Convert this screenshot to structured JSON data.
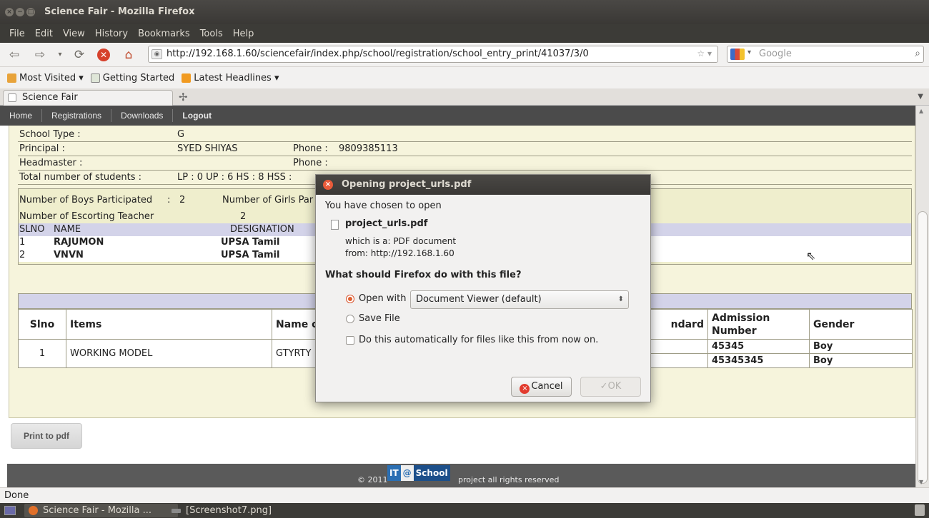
{
  "window": {
    "title": "Science Fair - Mozilla Firefox",
    "controls": [
      "×",
      "−",
      "□"
    ]
  },
  "menu": [
    "File",
    "Edit",
    "View",
    "History",
    "Bookmarks",
    "Tools",
    "Help"
  ],
  "toolbar": {
    "url": "http://192.168.1.60/sciencefair/index.php/school/registration/school_entry_print/41037/3/0",
    "search_placeholder": "Google",
    "icons": [
      "back-icon",
      "forward-icon",
      "history-dropdown-icon",
      "reload-icon",
      "stop-icon",
      "home-icon"
    ]
  },
  "bookmarks": [
    {
      "label": "Most Visited ▾",
      "color": "#e8a33a"
    },
    {
      "label": "Getting Started",
      "color": "#dfe6d8"
    },
    {
      "label": "Latest Headlines ▾",
      "color": "#f19a20"
    }
  ],
  "tabs": [
    {
      "label": "Science Fair"
    }
  ],
  "new_tab_symbol": "✢",
  "site_nav": [
    "Home",
    "Registrations",
    "Downloads",
    "Logout"
  ],
  "school": {
    "type_label": "School Type :",
    "type_value": "G",
    "principal_label": "Principal :",
    "principal_value": "SYED SHIYAS",
    "phone_label": "Phone :",
    "principal_phone": "9809385113",
    "headmaster_label": "Headmaster :",
    "headmaster_value": "",
    "headmaster_phone_label": "Phone :",
    "students_label": "Total number of students :",
    "students_value": "LP : 0 UP : 6 HS : 8 HSS :"
  },
  "participation": {
    "boys_label": "Number of Boys Participated",
    "boys_sep": ":",
    "boys_value": "2",
    "girls_label": "Number of Girls Par",
    "escort_label": "Number of Escorting Teacher",
    "escort_value": "2",
    "escort_headers": [
      "SLNO",
      "NAME",
      "DESIGNATION"
    ],
    "escorts": [
      {
        "slno": "1",
        "name": "RAJUMON",
        "designation": "UPSA Tamil"
      },
      {
        "slno": "2",
        "name": "VNVN",
        "designation": "UPSA Tamil"
      }
    ]
  },
  "items_table": {
    "headers": [
      "Slno",
      "Items",
      "Name o",
      "ndard",
      "Admission Number",
      "Gender"
    ],
    "rows": [
      {
        "slno": "1",
        "item": "WORKING MODEL",
        "name": "GTYRTY",
        "standard": "",
        "admission": "45345",
        "gender": "Boy"
      },
      {
        "slno": "",
        "item": "",
        "name": "",
        "standard": "",
        "admission": "45345345",
        "gender": "Boy"
      }
    ]
  },
  "print_button": "Print to pdf",
  "footer": {
    "copyright": "© 2011",
    "logo_it": "IT",
    "logo_at": "@",
    "logo_school": "School",
    "suffix": "project all rights reserved"
  },
  "status": "Done",
  "taskbar": [
    {
      "label": "Science Fair - Mozilla ...",
      "color": "#e0702a"
    },
    {
      "label": "[Screenshot7.png]",
      "color": "#8a8a8a"
    }
  ],
  "dialog": {
    "title": "Opening project_urls.pdf",
    "intro": "You have chosen to open",
    "filename": "project_urls.pdf",
    "which_is": "which is a:  PDF document",
    "from": "from: http://192.168.1.60",
    "question": "What should Firefox do with this file?",
    "open_with_label": "Open with",
    "open_with_value": "Document Viewer (default)",
    "save_file_label": "Save File",
    "auto_label": "Do this automatically for files like this from now on.",
    "cancel": "Cancel",
    "ok": "OK"
  }
}
